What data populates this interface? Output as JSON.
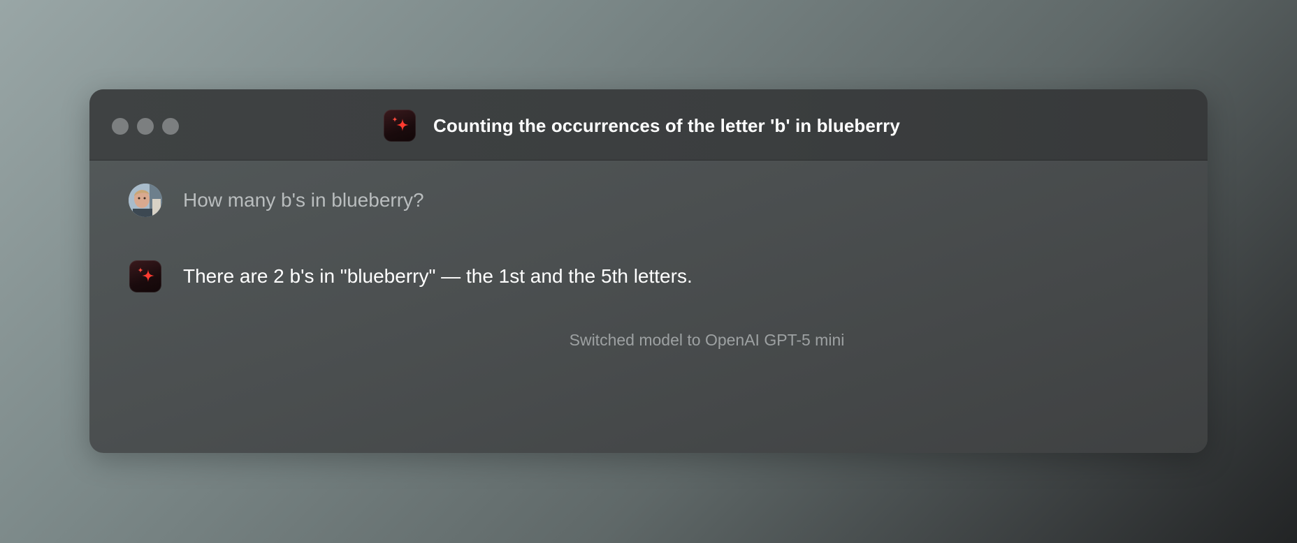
{
  "window": {
    "title": "Counting the occurrences of the letter 'b' in blueberry",
    "app_icon": "sparkle-icon",
    "traffic_lights": [
      "close",
      "minimize",
      "maximize"
    ]
  },
  "conversation": {
    "user_message": {
      "avatar": "user-avatar",
      "text": "How many b's in blueberry?"
    },
    "assistant_message": {
      "icon": "sparkle-icon",
      "text": "There are 2 b's in \"blueberry\" — the 1st and the 5th letters."
    },
    "system_note": "Switched model to OpenAI GPT-5 mini"
  },
  "colors": {
    "accent": "#ff3b30",
    "icon_bg": "#1a0b0d",
    "window_bg": "#4b4f50",
    "titlebar_bg": "#3b3e3f"
  }
}
